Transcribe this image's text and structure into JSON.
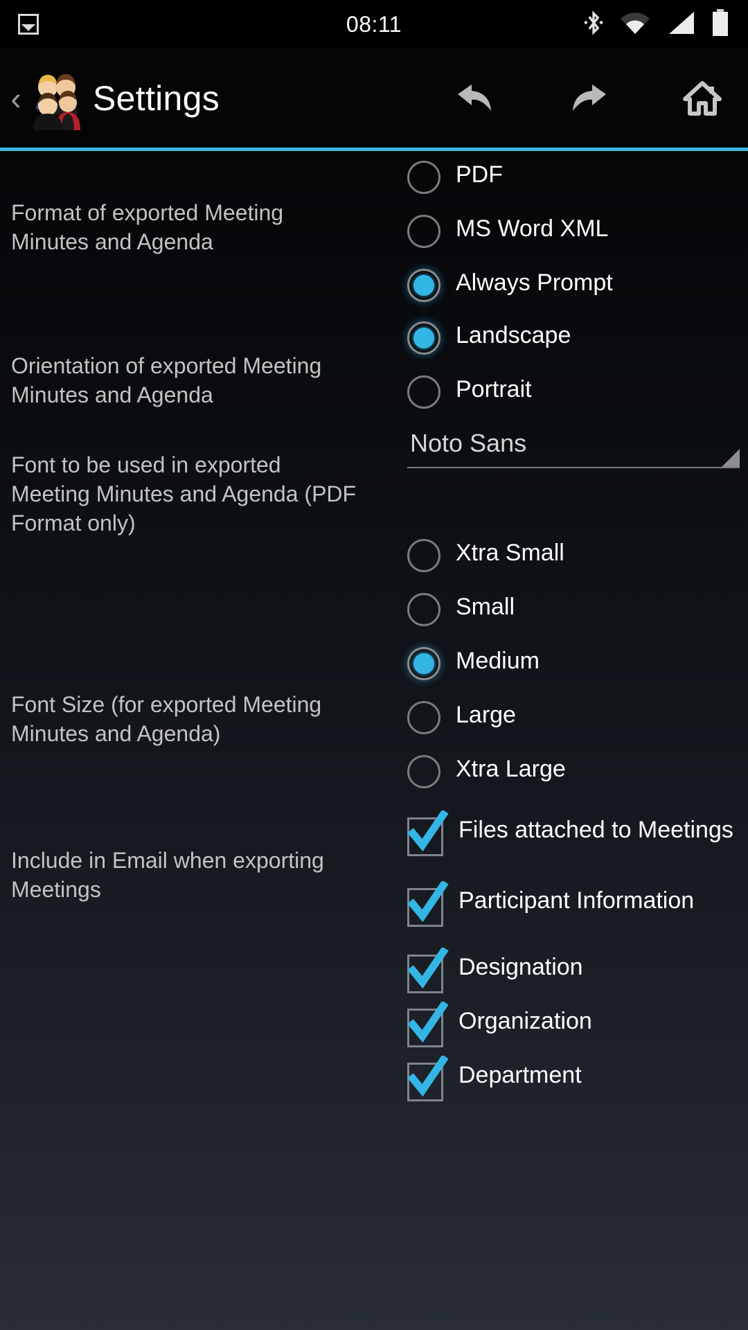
{
  "statusbar": {
    "time": "08:11",
    "icons": [
      "image-notification-icon",
      "bluetooth-icon",
      "wifi-icon",
      "cellular-signal-icon",
      "battery-icon"
    ]
  },
  "actionbar": {
    "title": "Settings",
    "back_chevron": "‹",
    "app_icon": "people-group-icon",
    "actions": [
      "undo-arrow-icon",
      "redo-arrow-icon",
      "home-icon"
    ]
  },
  "theme": {
    "accent": "#33b5e5",
    "divider": "#3bb7e0",
    "label_color": "#c3c3c3",
    "option_color": "#ffffff"
  },
  "settings": [
    {
      "id": "export-format",
      "label": "Format of exported Meeting Minutes and Agenda",
      "control": "radio",
      "options": [
        {
          "label": "PDF",
          "selected": false
        },
        {
          "label": "MS Word XML",
          "selected": false
        },
        {
          "label": "Always Prompt",
          "selected": true
        }
      ]
    },
    {
      "id": "export-orientation",
      "label": "Orientation of exported Meeting Minutes and Agenda",
      "control": "radio",
      "options": [
        {
          "label": "Landscape",
          "selected": true
        },
        {
          "label": "Portrait",
          "selected": false
        }
      ]
    },
    {
      "id": "export-font",
      "label": "Font to be used in exported Meeting Minutes and Agenda (PDF Format only)",
      "control": "spinner",
      "value": "Noto Sans"
    },
    {
      "id": "export-font-size",
      "label": "Font Size (for exported Meeting Minutes and Agenda)",
      "control": "radio",
      "options": [
        {
          "label": "Xtra Small",
          "selected": false
        },
        {
          "label": "Small",
          "selected": false
        },
        {
          "label": "Medium",
          "selected": true
        },
        {
          "label": "Large",
          "selected": false
        },
        {
          "label": "Xtra Large",
          "selected": false
        }
      ]
    },
    {
      "id": "include-in-email",
      "label": "Include in Email when exporting Meetings",
      "control": "checkbox",
      "options": [
        {
          "label": "Files attached to Meetings",
          "checked": true
        },
        {
          "label": "Participant Information",
          "checked": true
        },
        {
          "label": "Designation",
          "checked": true
        },
        {
          "label": "Organization",
          "checked": true
        },
        {
          "label": "Department",
          "checked": true
        }
      ]
    }
  ]
}
